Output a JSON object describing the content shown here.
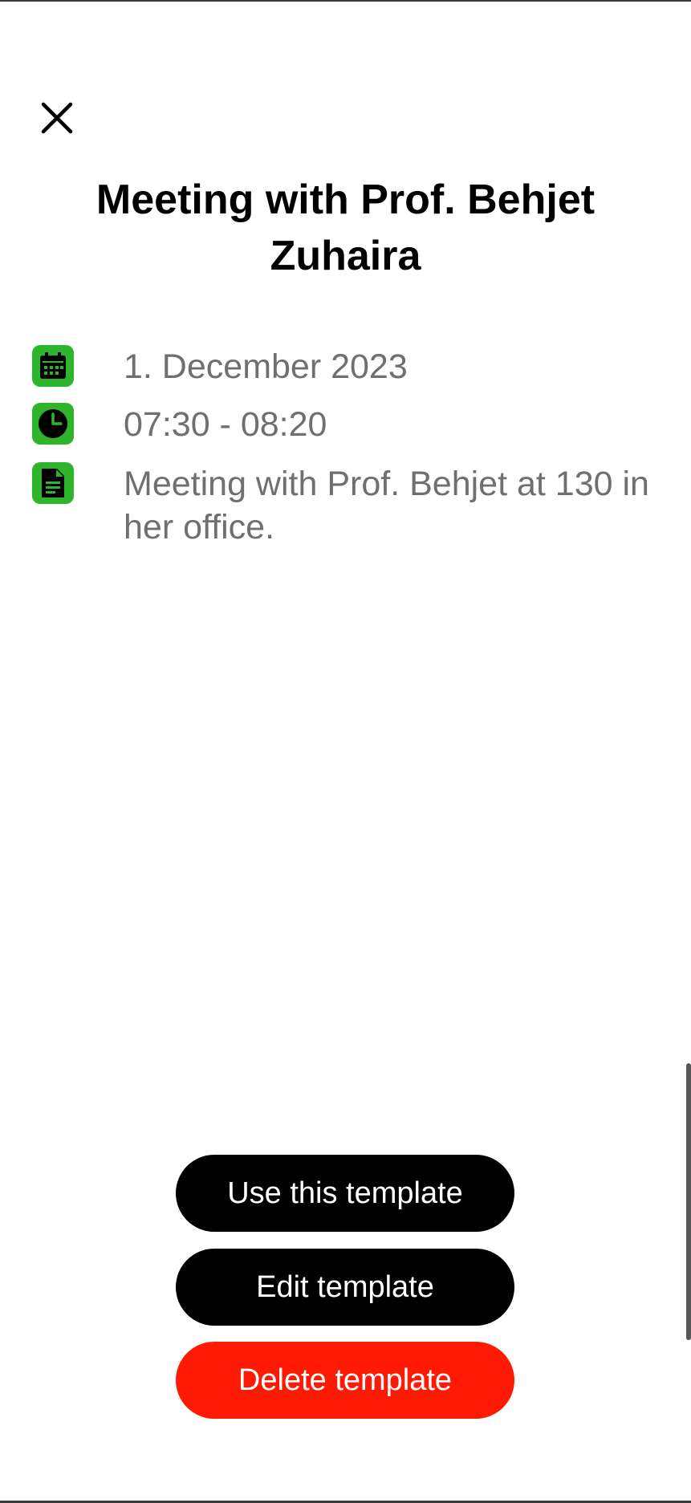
{
  "header": {
    "close_icon": "close-icon",
    "title": "Meeting with Prof. Behjet Zuhaira"
  },
  "details": {
    "date": {
      "icon": "calendar-icon",
      "text": "1. December 2023"
    },
    "time": {
      "icon": "clock-icon",
      "text": "07:30 - 08:20"
    },
    "note": {
      "icon": "document-icon",
      "text": "Meeting with Prof. Behjet at 130 in her office."
    }
  },
  "actions": {
    "use_label": "Use this template",
    "edit_label": "Edit template",
    "delete_label": "Delete template"
  },
  "colors": {
    "icon_bg": "#2fb52c",
    "text_gray": "#6f6f6f",
    "button_dark": "#000000",
    "delete_red": "#ff1a05"
  }
}
